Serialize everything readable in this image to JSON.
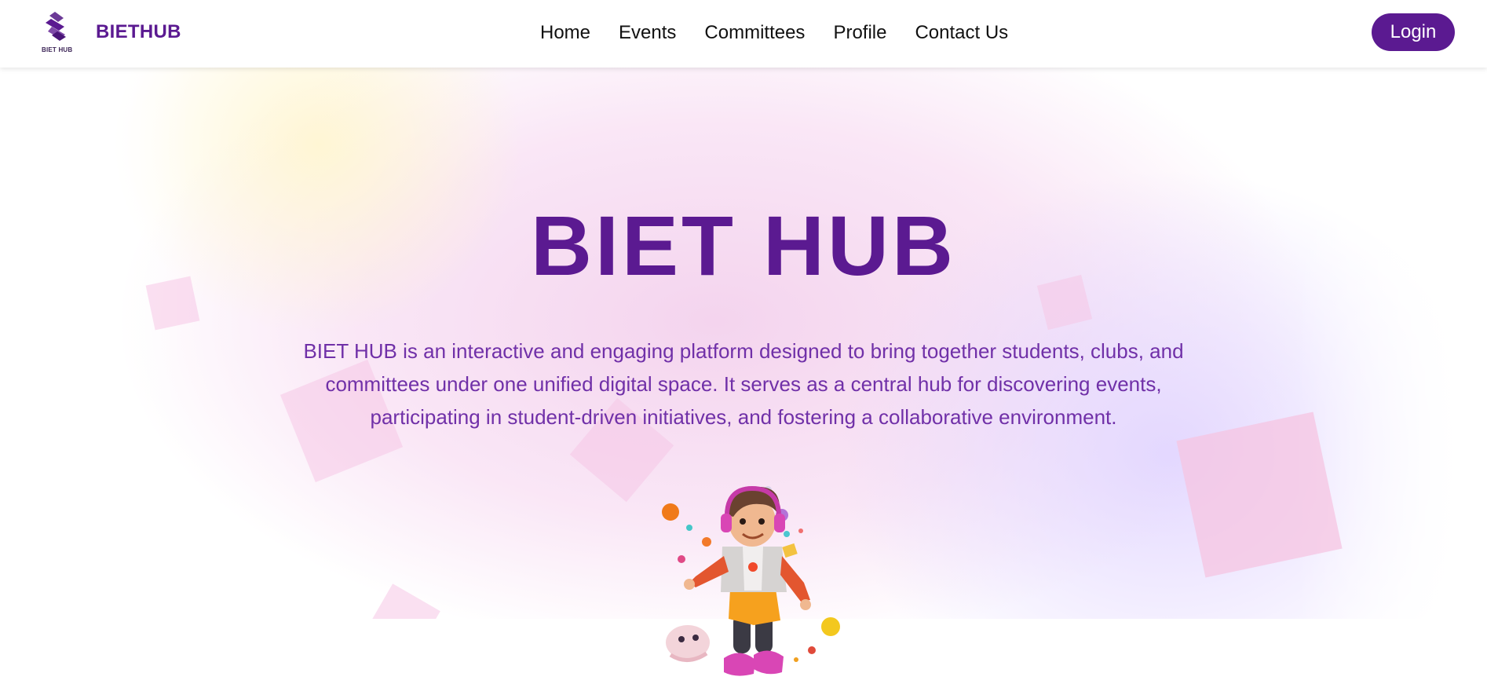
{
  "header": {
    "brand_name": "BIETHUB",
    "logo_text": "BIET HUB",
    "nav": [
      "Home",
      "Events",
      "Committees",
      "Profile",
      "Contact Us"
    ],
    "login_label": "Login"
  },
  "hero": {
    "title": "BIET HUB",
    "description": "BIET HUB is an interactive and engaging platform designed to bring together students, clubs, and committees under one unified digital space. It serves as a central hub for discovering events, participating in student-driven initiatives, and fostering a collaborative environment."
  },
  "colors": {
    "brand": "#5b1a91",
    "text_accent": "#7030a8",
    "hero_pink": "#f4d4ee",
    "hero_lavender": "#e2d6ff"
  },
  "icons": {
    "logo": "biet-hub-logo-icon",
    "character": "cartoon-boy-with-headphones-illustration"
  }
}
